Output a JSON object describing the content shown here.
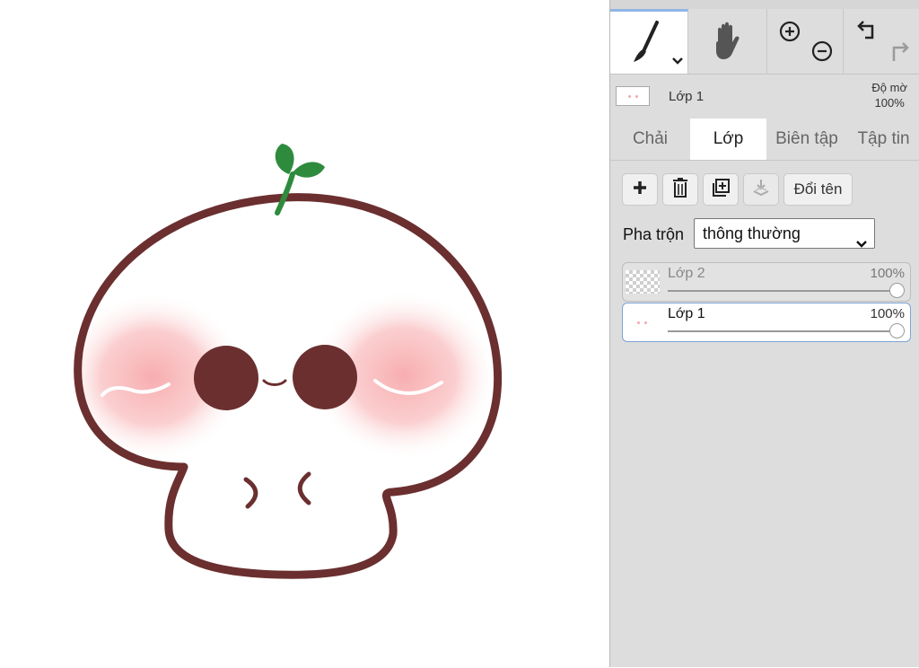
{
  "toolbar": {
    "brush_icon": "brush-icon",
    "hand_icon": "hand-icon",
    "zoom_in_icon": "zoom-in-icon",
    "zoom_out_icon": "zoom-out-icon",
    "undo_icon": "undo-icon",
    "redo_icon": "redo-icon"
  },
  "current_layer": {
    "name": "Lớp 1",
    "opacity_label_line1": "Độ mờ",
    "opacity_value": "100%"
  },
  "tabs": [
    {
      "label": "Chải",
      "active": false
    },
    {
      "label": "Lớp",
      "active": true
    },
    {
      "label": "Biên tập",
      "active": false
    },
    {
      "label": "Tập tin",
      "active": false
    }
  ],
  "layer_actions": {
    "add_icon": "plus-icon",
    "delete_icon": "trash-icon",
    "duplicate_icon": "duplicate-icon",
    "merge_icon": "merge-down-icon",
    "rename_label": "Đổi tên"
  },
  "blend": {
    "label": "Pha trộn",
    "selected": "thông thường"
  },
  "layers": [
    {
      "name": "Lớp 2",
      "opacity": "100%",
      "selected": false
    },
    {
      "name": "Lớp 1",
      "opacity": "100%",
      "selected": true
    }
  ],
  "colors": {
    "outline": "#6b2f2f",
    "blush": "#f7a9ab",
    "sprout": "#2e8b3e",
    "panel_bg": "#dddddd",
    "accent": "#8fb6e6"
  }
}
